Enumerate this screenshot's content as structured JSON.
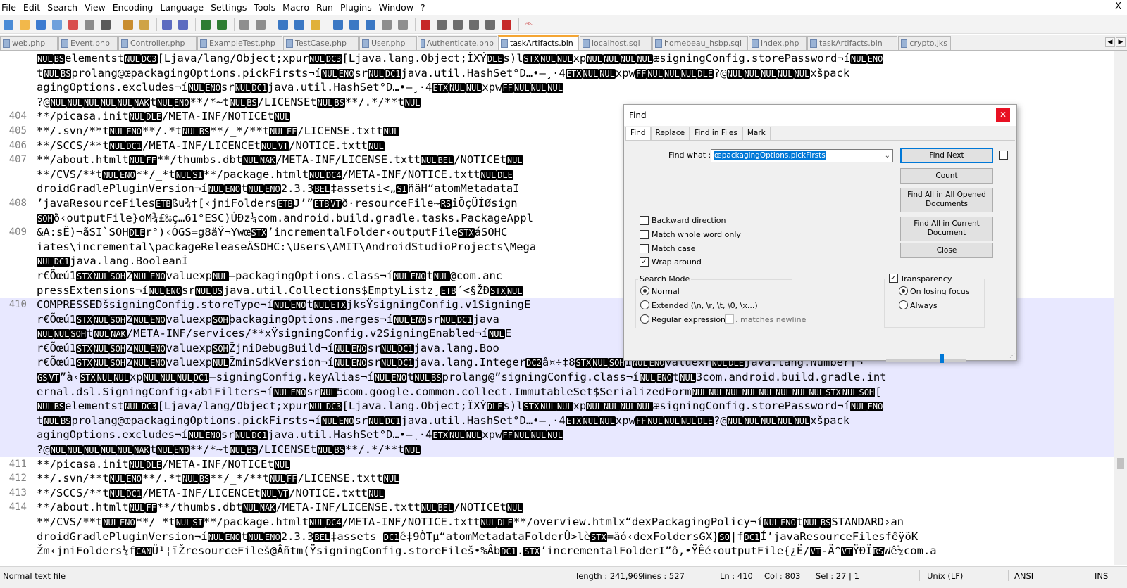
{
  "menu": [
    "File",
    "Edit",
    "Search",
    "View",
    "Encoding",
    "Language",
    "Settings",
    "Tools",
    "Macro",
    "Run",
    "Plugins",
    "Window",
    "?"
  ],
  "window_close": "X",
  "tabs": [
    {
      "label": "web.php",
      "active": false
    },
    {
      "label": "Event.php",
      "active": false
    },
    {
      "label": "Controller.php",
      "active": false
    },
    {
      "label": "ExampleTest.php",
      "active": false
    },
    {
      "label": "TestCase.php",
      "active": false
    },
    {
      "label": "User.php",
      "active": false
    },
    {
      "label": "Authenticate.php",
      "active": false
    },
    {
      "label": "taskArtifacts.bin",
      "active": true
    },
    {
      "label": "localhost.sql",
      "active": false
    },
    {
      "label": "homebeau_hsbp.sql",
      "active": false
    },
    {
      "label": "index.php",
      "active": false
    },
    {
      "label": "taskArtifacts.bin",
      "active": false
    },
    {
      "label": "crypto.jks",
      "active": false
    }
  ],
  "editor_lines": [
    {
      "n": "",
      "t": "NUL BS elementst NUL DC3 [Ljava/lang/Object;xpur NUL DC3 [Ljava.lang.Object;ÎXÝ DLE s)l STX NUL NUL xp NUL NUL NUL NUL æsigningConfig.storePassword¬í NUL ENO"
    },
    {
      "n": "",
      "t": "t NUL BS prolang@œpackagingOptions.pickFirsts¬í NUL ENO sr NUL DC1 java.util.HashSet°D…•–¸·4 ETX NUL NUL xpw FF NUL NUL NUL DLE ?@ NUL NUL NUL NUL NUL xšpack"
    },
    {
      "n": "",
      "t": "agingOptions.excludes¬í NUL ENO sr NUL DC1 java.util.HashSet°D…•–¸·4 ETX NUL NUL xpw FF NUL NUL NUL"
    },
    {
      "n": "",
      "t": "?@ NUL NUL NUL NUL NUL NAK t NUL ENO **/*~t NUL BS /LICENSEt NUL BS **/.*/**t NUL"
    },
    {
      "n": "404",
      "t": "**/picasa.init NUL DLE /META-INF/NOTICEt NUL"
    },
    {
      "n": "405",
      "t": "**/.svn/**t NUL ENO **/.*t NUL BS **/_*/**t NUL FF /LICENSE.txtt NUL"
    },
    {
      "n": "406",
      "t": "**/SCCS/**t NUL DC1 /META-INF/LICENCEt NUL VT /NOTICE.txtt NUL"
    },
    {
      "n": "407",
      "t": "**/about.htmlt NUL FF **/thumbs.dbt NUL NAK /META-INF/LICENSE.txtt NUL BEL /NOTICEt NUL"
    },
    {
      "n": "",
      "t": "**/CVS/**t NUL ENO **/_*t NUL SI **/package.htmlt NUL DC4 /META-INF/NOTICE.txtt NUL DLE                                                           STANDARD›an"
    },
    {
      "n": "",
      "t": "droidGradlePluginVersion¬í NUL ENO t NUL ENO 2.3.3 BEL ‡assetsi<„ SI ñäH“atomMetadataI"
    },
    {
      "n": "408",
      "t": "’javaResourceFiles ETB ßu ¾†[‹jniFolders ETB J’” ETB VT ð·resourceFile~ RS îÕçÜÍØsign                                               eræ(ä NUL FF g"
    },
    {
      "n": "",
      "t": " SOH õ‹outputFile}oM¾£‰ç…61°ESC)ÚĐz¼com.android.build.gradle.tasks.PackageAppl"
    },
    {
      "n": "409",
      "t": "&A:sË)¬ãSI`SOH DLE r°)‹ÓGS=g8äŸ¬Ywœ STX ’incrementalFolder‹outputFile STX áSOHC                                                         ild\\intermed"
    },
    {
      "n": "",
      "t": "iates\\incremental\\packageReleaseÂSOHC:\\Users\\AMIT\\AndroidStudioProjects\\Mega_                                                        ¬í NUL ENO sr"
    },
    {
      "n": "",
      "t": " NUL DC1 java.lang.BooleanÍ"
    },
    {
      "n": "",
      "t": "r€Õœú1 STX NUL SOH Z NUL ENO valuexp NUL —packagingOptions.class¬í NUL ENO t NUL @com.anc                                                        orated•noCom"
    },
    {
      "n": "",
      "t": "pressExtensions¬í NUL ENO sr NUL US java.util.Collections$EmptyListz¸ ETB ´<§ŽÐ STX NUL"
    },
    {
      "n": "410",
      "t": "COMPRESSEDšsigningConfig.storeType¬í NUL ENO t NUL ETX jksŸsigningConfig.v1SigningE",
      "cur": true
    },
    {
      "n": "",
      "t": "r€Õœú1 STX NUL SOH Z NUL ENO valuexp SOH þackagingOptions.merges¬í NUL ENO sr NUL DC1 java                                                    NUL NUL NUL",
      "cur": true
    },
    {
      "n": "",
      "t": " NUL NUL SOH t NUL NAK /META-INF/services/**xŸsigningConfig.v2SigningEnabled¬í NUL E",
      "cur": true
    },
    {
      "n": "",
      "t": "r€Õœú1 STX NUL SOH Z NUL ENO valuexp SOH ŽjniDebugBuild¬í NUL ENO sr NUL DC1 java.lang.Boo",
      "cur": true
    },
    {
      "n": "",
      "t": "r€Õœú1 STX NUL SOH Z NUL ENO valuexp NUL ŽminSdkVersion¬í NUL ENO sr NUL DC1 java.lang.Integer DC2 â ¤÷‡8 STX NUL SOH I NUL ENO valuexr NUL DLE java.lang.Number†¬",
      "cur": true
    },
    {
      "n": "",
      "t": " GS VT ”à‹ STX NUL NUL xp NUL NUL NUL DC1 —signingConfig.keyAlias¬í NUL ENO t NUL BS prolang@”signingConfig.class¬í NUL ENO t NUL 3com.android.build.gradle.int",
      "cur": true
    },
    {
      "n": "",
      "t": "ernal.dsl.SigningConfig‹abiFilters¬í NUL ENO sr NUL 5com.google.common.collect.ImmutableSet$SerializedForm NUL NUL NUL NUL NUL NUL NUL NUL STX NUL SOH [",
      "cur": true
    },
    {
      "n": "",
      "t": " NUL BS elementst NUL DC3 [Ljava/lang/Object;xpur NUL DC3 [Ljava.lang.Object;ÎXÝ DLE s)l STX NUL NUL xp NUL NUL NUL NUL æsigningConfig.storePassword¬í NUL ENO",
      "cur": true
    },
    {
      "n": "",
      "t": "t NUL BS prolang@œpackagingOptions.pickFirsts¬í NUL ENO sr NUL DC1 java.util.HashSet°D…•–¸·4 ETX NUL NUL xpw FF NUL NUL NUL DLE ?@ NUL NUL NUL NUL NUL xšpack",
      "cur": true
    },
    {
      "n": "",
      "t": "agingOptions.excludes¬í NUL ENO sr NUL DC1 java.util.HashSet°D…•–¸·4 ETX NUL NUL xpw FF NUL NUL NUL",
      "cur": true
    },
    {
      "n": "",
      "t": "?@ NUL NUL NUL NUL NUL NAK t NUL ENO **/*~t NUL BS /LICENSEt NUL BS **/.*/**t NUL",
      "cur": true
    },
    {
      "n": "411",
      "t": "**/picasa.init NUL DLE /META-INF/NOTICEt NUL"
    },
    {
      "n": "412",
      "t": "**/.svn/**t NUL ENO **/.*t NUL BS **/_*/**t NUL FF /LICENSE.txtt NUL"
    },
    {
      "n": "413",
      "t": "**/SCCS/**t NUL DC1 /META-INF/LICENCEt NUL VT /NOTICE.txtt NUL"
    },
    {
      "n": "414",
      "t": "**/about.htmlt NUL FF **/thumbs.dbt NUL NAK /META-INF/LICENSE.txtt NUL BEL /NOTICEt NUL"
    },
    {
      "n": "",
      "t": "**/CVS/**t NUL ENO **/_*t NUL SI **/package.htmlt NUL DC4 /META-INF/NOTICE.txtt NUL DLE **/overview.htmlx“dexPackagingPolicy¬í NUL ENO t NUL BS STANDARD›an"
    },
    {
      "n": "",
      "t": "droidGradlePluginVersion¬í NUL ENO t NUL ENO 2.3.3 BEL ‡assets  DC1 ê‡9ÒTµ“atomMetadataFolderÛ>lè STX =äó‹dexFoldersGX} SO |f DC1 Í’javaResourceFilesfêÿõK"
    },
    {
      "n": "",
      "t": "Žm‹jniFolders¼f CAN Ü¹¦ïŽresourceFileš@Âñtm(ŸsigningConfig.storeFileš•%Âb DC1 . STX ’incrementalFolderI”ô,•ŸÊé‹outputFile{¿Ë/ VT -Ä^ VT ŸÐÏ RS Wê¼com.a"
    }
  ],
  "find_dialog": {
    "title": "Find",
    "close": "✕",
    "tabs": [
      "Find",
      "Replace",
      "Find in Files",
      "Mark"
    ],
    "find_what_label": "Find what :",
    "find_what_value": "œpackagingOptions.pickFirsts",
    "buttons": {
      "find_next": "Find Next",
      "count": "Count",
      "find_all_opened": "Find All in All Opened Documents",
      "find_all_current": "Find All in Current Document",
      "close": "Close"
    },
    "options": {
      "backward": "Backward direction",
      "whole_word": "Match whole word only",
      "match_case": "Match case",
      "wrap_around": "Wrap around"
    },
    "wrap_checked": true,
    "search_mode_label": "Search Mode",
    "modes": [
      "Normal",
      "Extended (\\n, \\r, \\t, \\0, \\x...)",
      "Regular expression"
    ],
    "selected_mode": "Normal",
    "matches_newline": ". matches newline",
    "transparency_label": "Transparency",
    "transparency_checked": true,
    "transparency_modes": [
      "On losing focus",
      "Always"
    ],
    "transparency_selected": "On losing focus",
    "transparency_level": 0.73
  },
  "status": {
    "file_type": "Normal text file",
    "length": "length : 241,969",
    "lines": "lines : 527",
    "ln": "Ln : 410",
    "col": "Col : 803",
    "sel": "Sel : 27 | 1",
    "eol": "Unix (LF)",
    "encoding": "ANSI",
    "mode": "INS"
  }
}
